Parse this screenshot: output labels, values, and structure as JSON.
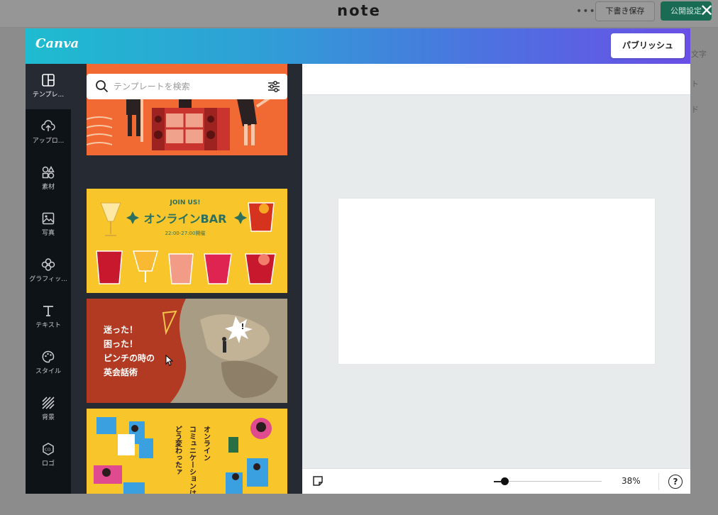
{
  "note": {
    "logo": "note",
    "more": "•••",
    "draft_button": "下書き保存",
    "publish_settings_button": "公開設定",
    "side_labels": [
      "文字",
      "ト",
      "ド"
    ]
  },
  "canva": {
    "logo": "Canva",
    "publish_button": "パブリッシュ",
    "nav": [
      {
        "label": "テンプレ...",
        "icon": "template-icon"
      },
      {
        "label": "アップロ...",
        "icon": "upload-icon"
      },
      {
        "label": "素材",
        "icon": "elements-icon"
      },
      {
        "label": "写真",
        "icon": "photo-icon"
      },
      {
        "label": "グラフィッ...",
        "icon": "graphics-icon"
      },
      {
        "label": "テキスト",
        "icon": "text-icon"
      },
      {
        "label": "スタイル",
        "icon": "style-icon"
      },
      {
        "label": "背景",
        "icon": "background-icon"
      },
      {
        "label": "ロゴ",
        "icon": "logo-icon"
      }
    ],
    "search": {
      "placeholder": "テンプレートを検索",
      "value": ""
    },
    "templates": {
      "t2": {
        "badge": "JOIN US!",
        "title": "オンラインBAR",
        "time": "22:00-27:00開催"
      },
      "t3": {
        "lines": [
          "迷った！",
          "困った！",
          "ピンチの時の",
          "英会話術"
        ]
      },
      "t4": {
        "lines": [
          "オンライン",
          "コミュニケーションは",
          "どう変わったァ"
        ]
      }
    },
    "zoom": "38%",
    "help": "?",
    "close": "✕"
  }
}
